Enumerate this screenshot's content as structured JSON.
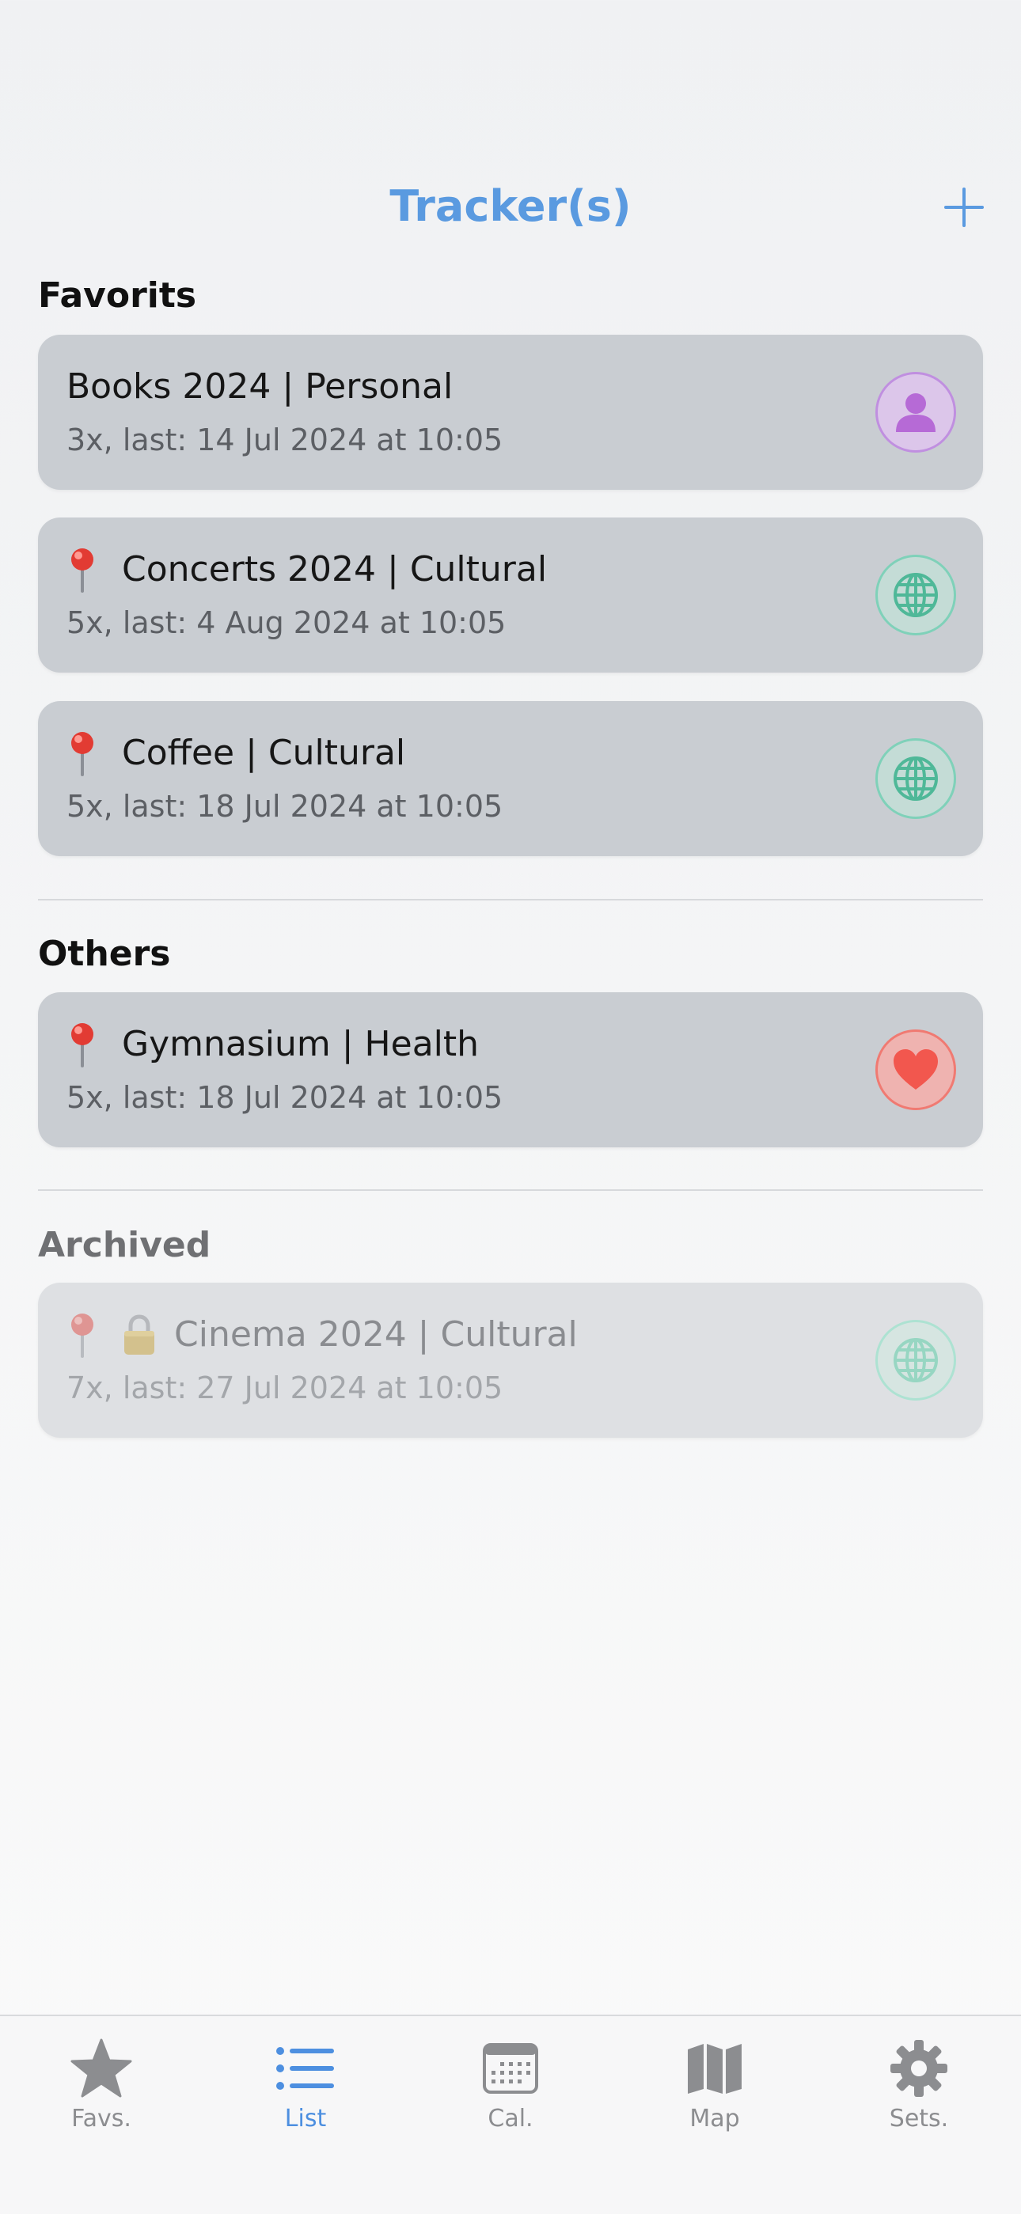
{
  "header": {
    "title": "Tracker(s)"
  },
  "colors": {
    "accent": "#5a9ae0",
    "card_bg": "#c9cdd2",
    "personal": "#b66ad6",
    "cultural": "#5ec4a6",
    "health": "#f2574e"
  },
  "sections": {
    "favorites": {
      "title": "Favorits",
      "items": [
        {
          "name": "Books 2024 | Personal",
          "meta": "3x, last: 14 Jul 2024 at 10:05",
          "icon": "person-icon"
        },
        {
          "name": "Concerts 2024 | Cultural",
          "meta": "5x, last: 4 Aug 2024 at 10:05",
          "icon": "globe-icon",
          "pinned": true
        },
        {
          "name": "Coffee | Cultural",
          "meta": "5x, last: 18 Jul 2024 at 10:05",
          "icon": "globe-icon",
          "pinned": true
        }
      ]
    },
    "others": {
      "title": "Others",
      "items": [
        {
          "name": "Gymnasium | Health",
          "meta": "5x, last: 18 Jul 2024 at 10:05",
          "icon": "heart-icon",
          "pinned": true
        }
      ]
    },
    "archived": {
      "title": "Archived",
      "items": [
        {
          "name": "Cinema 2024 | Cultural",
          "meta": "7x, last: 27 Jul 2024 at 10:05",
          "icon": "globe-icon",
          "pinned": true,
          "locked": true
        }
      ]
    }
  },
  "tabbar": {
    "tabs": [
      {
        "label": "Favs.",
        "icon": "star-icon",
        "active": false
      },
      {
        "label": "List",
        "icon": "list-icon",
        "active": true
      },
      {
        "label": "Cal.",
        "icon": "calendar-icon",
        "active": false
      },
      {
        "label": "Map",
        "icon": "map-icon",
        "active": false
      },
      {
        "label": "Sets.",
        "icon": "gear-icon",
        "active": false
      }
    ]
  }
}
